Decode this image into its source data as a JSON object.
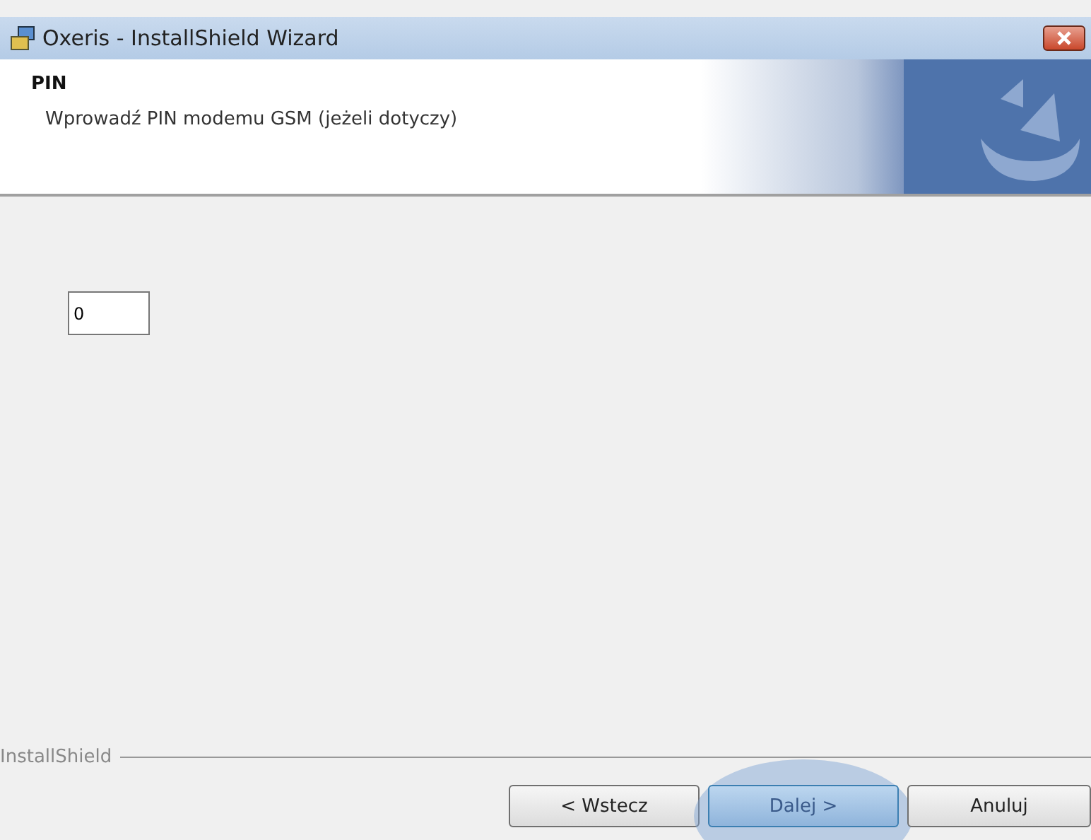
{
  "window": {
    "title": "Oxeris - InstallShield Wizard"
  },
  "header": {
    "title": "PIN",
    "subtitle": "Wprowadź PIN modemu GSM (jeżeli dotyczy)"
  },
  "pin_field": {
    "value": "0"
  },
  "footer": {
    "brand": "InstallShield"
  },
  "buttons": [
    {
      "label": "< Wstecz",
      "highlighted": false
    },
    {
      "label": "Dalej >",
      "highlighted": true
    },
    {
      "label": "Anuluj",
      "highlighted": false
    }
  ]
}
